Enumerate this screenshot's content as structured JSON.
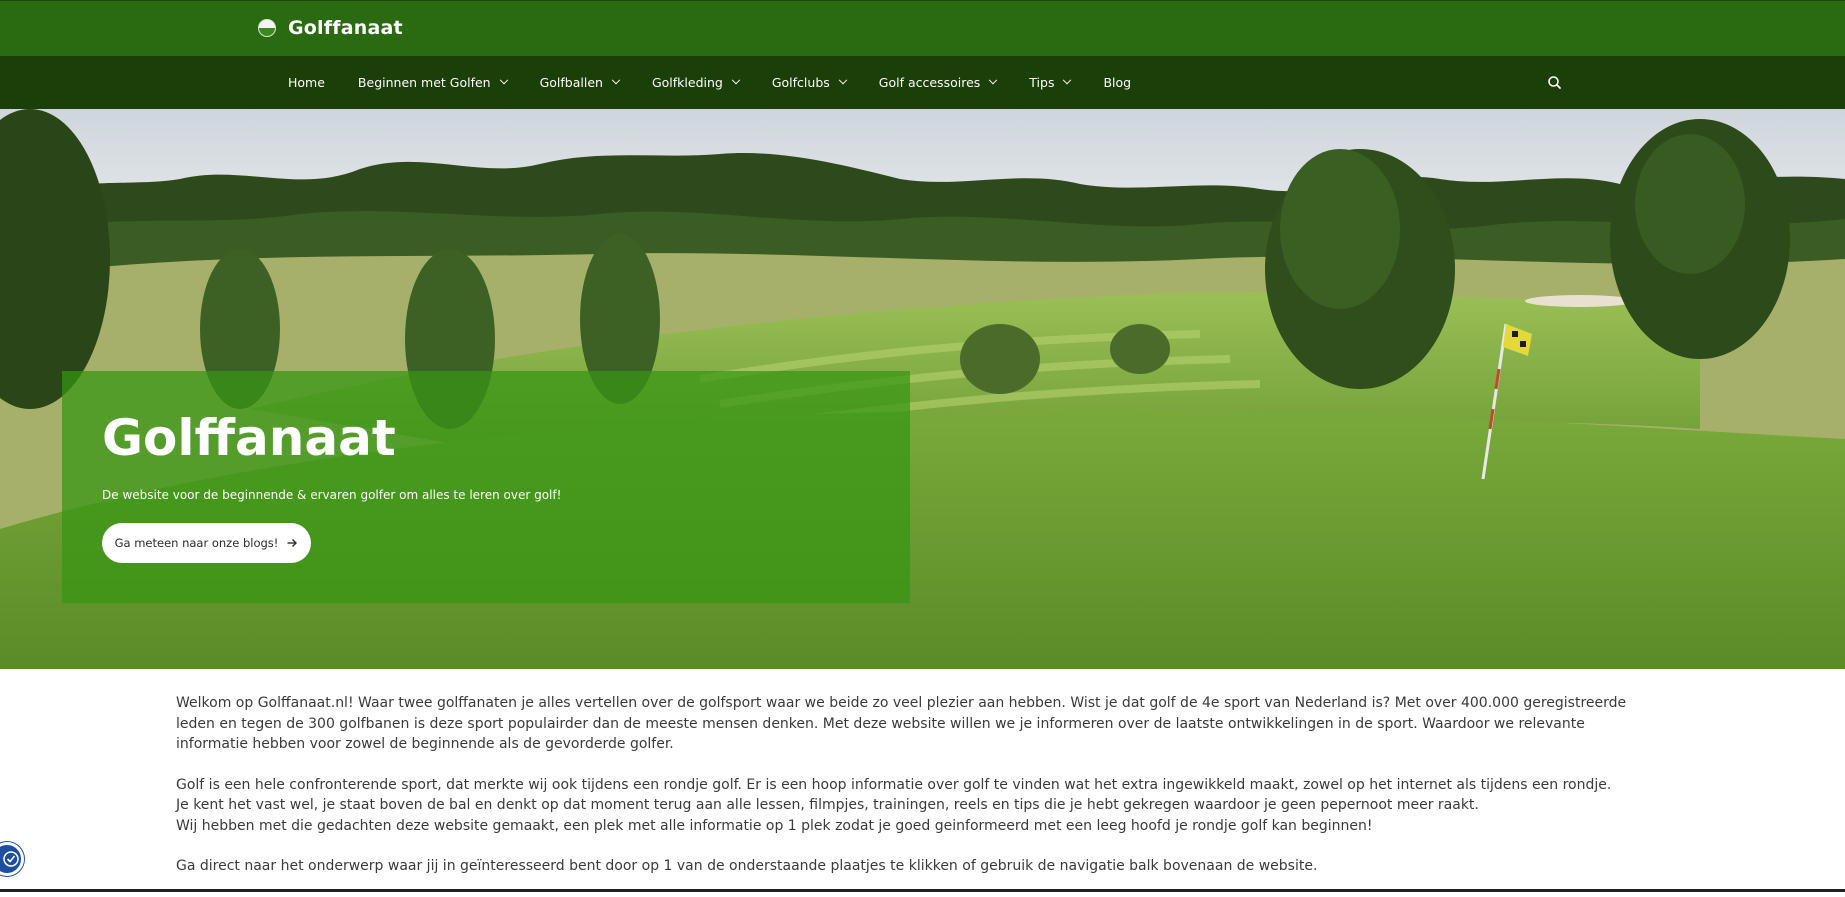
{
  "site": {
    "title": "Golffanaat"
  },
  "nav": {
    "items": [
      {
        "label": "Home",
        "dropdown": false
      },
      {
        "label": "Beginnen met Golfen",
        "dropdown": true
      },
      {
        "label": "Golfballen",
        "dropdown": true
      },
      {
        "label": "Golfkleding",
        "dropdown": true
      },
      {
        "label": "Golfclubs",
        "dropdown": true
      },
      {
        "label": "Golf accessoires",
        "dropdown": true
      },
      {
        "label": "Tips",
        "dropdown": true
      },
      {
        "label": "Blog",
        "dropdown": false
      }
    ],
    "search_icon": "search-icon"
  },
  "hero": {
    "title": "Golffanaat",
    "subtitle": "De website voor de beginnende & ervaren golfer om alles te leren over golf!",
    "cta_label": "Ga meteen naar onze blogs!",
    "cta_icon": "arrow-right-icon"
  },
  "content": {
    "paragraphs": [
      "Welkom op Golffanaat.nl! Waar twee golffanaten je alles vertellen over de golfsport waar we beide zo veel plezier aan hebben. Wist je dat golf de 4e sport van Nederland is? Met over 400.000 geregistreerde leden en tegen de 300 golfbanen is deze sport populairder dan de meeste mensen denken. Met deze website willen we je informeren over de laatste ontwikkelingen in de sport. Waardoor we relevante informatie hebben voor zowel de beginnende als de gevorderde golfer.",
      "Golf is een hele confronterende sport, dat merkte wij ook tijdens een rondje golf. Er is een hoop informatie over golf te vinden wat het extra ingewikkeld maakt, zowel op het internet als tijdens een rondje.",
      "Je kent het vast wel, je staat boven de bal en denkt op dat moment terug aan alle lessen, filmpjes, trainingen, reels en tips die je hebt gekregen waardoor je geen pepernoot meer raakt.",
      "Wij hebben met die gedachten deze website gemaakt, een plek met alle informatie op 1 plek zodat je goed geinformeerd met een leeg hoofd je rondje golf kan beginnen!",
      "Ga direct naar het onderwerp waar jij in geïnteresseerd bent door op 1 van de onderstaande plaatjes te klikken of gebruik de navigatie balk bovenaan de website."
    ]
  },
  "colors": {
    "topbar": "#2a6b11",
    "navbar": "#1b3f08",
    "hero_overlay": "#3696147a",
    "a11y_button": "#1d4fa0"
  },
  "accessibility": {
    "icon": "accessibility-icon"
  }
}
